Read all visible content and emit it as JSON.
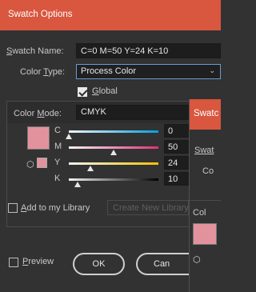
{
  "dialog": {
    "title": "Swatch Options",
    "swatch_name": {
      "label_prefix": "S",
      "label_rest": "watch Name:",
      "value": "C=0 M=50 Y=24 K=10"
    },
    "color_type": {
      "label_pre": "Color ",
      "label_u": "T",
      "label_rest": "ype:",
      "value": "Process Color"
    },
    "global": {
      "label_u": "G",
      "label_rest": "lobal",
      "checked": true
    },
    "color_mode": {
      "label_pre": "Color ",
      "label_u": "M",
      "label_rest": "ode:",
      "value": "CMYK"
    },
    "swatch_color": "#e2929d",
    "sliders": [
      {
        "label": "C",
        "value": "0",
        "percent": 0
      },
      {
        "label": "M",
        "value": "50",
        "percent": 50
      },
      {
        "label": "Y",
        "value": "24",
        "percent": 24
      },
      {
        "label": "K",
        "value": "10",
        "percent": 10
      }
    ],
    "library": {
      "label_u": "A",
      "label_rest": "dd to my Library",
      "checked": false,
      "create_button": "Create New Library..."
    },
    "preview": {
      "label_u": "P",
      "label_rest": "review",
      "checked": false
    },
    "ok_label": "OK",
    "cancel_label": "Can"
  },
  "second_dialog": {
    "title": "Swatc",
    "swatch_name_label": "Swat",
    "color_label": "Co",
    "mode_label": "Col"
  }
}
